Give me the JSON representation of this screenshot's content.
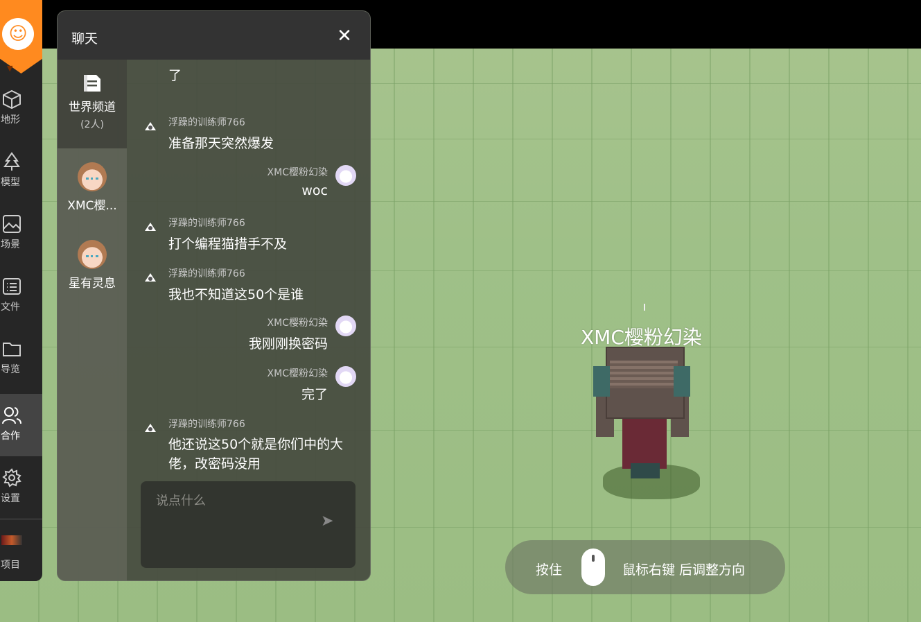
{
  "sidebar": {
    "items": [
      {
        "label": "地形",
        "icon": "cube-icon"
      },
      {
        "label": "模型",
        "icon": "tree-icon"
      },
      {
        "label": "场景",
        "icon": "image-icon"
      },
      {
        "label": "文件",
        "icon": "list-icon"
      },
      {
        "label": "导览",
        "icon": "folder-icon"
      },
      {
        "label": "合作",
        "icon": "users-icon",
        "active": true
      },
      {
        "label": "设置",
        "icon": "gear-icon"
      },
      {
        "label": "项目",
        "icon": "project-thumbnail-icon"
      }
    ]
  },
  "chat": {
    "title": "聊天",
    "channels": [
      {
        "name": "世界频道",
        "sub": "(2人)"
      },
      {
        "name": "XMC樱...",
        "sub": ""
      },
      {
        "name": "星有灵息",
        "sub": ""
      }
    ],
    "messages": [
      {
        "side": "left",
        "name": "",
        "text": "了"
      },
      {
        "side": "left",
        "name": "浮躁的训练师766",
        "text": "准备那天突然爆发"
      },
      {
        "side": "right",
        "name": "XMC樱粉幻染",
        "text": "woc"
      },
      {
        "side": "left",
        "name": "浮躁的训练师766",
        "text": "打个编程猫措手不及"
      },
      {
        "side": "left",
        "name": "浮躁的训练师766",
        "text": "我也不知道这50个是谁"
      },
      {
        "side": "right",
        "name": "XMC樱粉幻染",
        "text": "我刚刚换密码"
      },
      {
        "side": "right",
        "name": "XMC樱粉幻染",
        "text": "完了"
      },
      {
        "side": "left",
        "name": "浮躁的训练师766",
        "text": "他还说这50个就是你们中的大佬，改密码没用"
      }
    ],
    "input_placeholder": "说点什么"
  },
  "scene": {
    "player_name": "XMC樱粉幻染"
  },
  "hint": {
    "hold": "按住",
    "action": "鼠标右键  后调整方向"
  }
}
